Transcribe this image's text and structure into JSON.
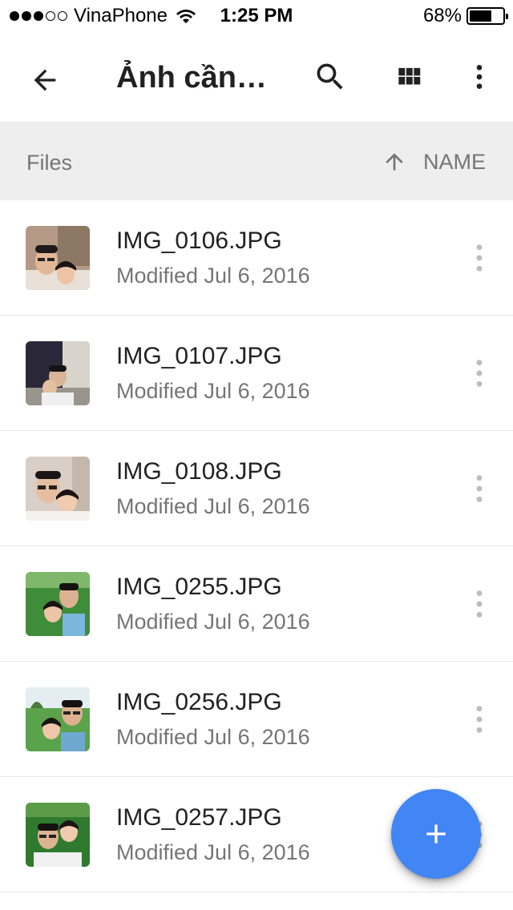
{
  "status_bar": {
    "carrier": "VinaPhone",
    "time": "1:25 PM",
    "battery_text": "68%",
    "battery_level": 0.68,
    "signal_bars_filled": 3,
    "signal_bars_total": 5
  },
  "toolbar": {
    "title": "Ảnh cần…",
    "back_icon": "arrow-back-icon",
    "search_icon": "search-icon",
    "grid_icon": "grid-view-icon",
    "more_icon": "more-vert-icon"
  },
  "sort_header": {
    "section_label": "Files",
    "sort_label": "NAME",
    "sort_direction_icon": "arrow-up-icon"
  },
  "files": [
    {
      "name": "IMG_0106.JPG",
      "meta": "Modified Jul 6, 2016"
    },
    {
      "name": "IMG_0107.JPG",
      "meta": "Modified Jul 6, 2016"
    },
    {
      "name": "IMG_0108.JPG",
      "meta": "Modified Jul 6, 2016"
    },
    {
      "name": "IMG_0255.JPG",
      "meta": "Modified Jul 6, 2016"
    },
    {
      "name": "IMG_0256.JPG",
      "meta": "Modified Jul 6, 2016"
    },
    {
      "name": "IMG_0257.JPG",
      "meta": "Modified Jul 6, 2016"
    }
  ],
  "fab": {
    "icon": "plus-icon",
    "color": "#4285f4"
  },
  "colors": {
    "primary_text": "#212121",
    "secondary_text": "#757575",
    "header_bg": "#eeeeee",
    "accent": "#4285f4"
  }
}
